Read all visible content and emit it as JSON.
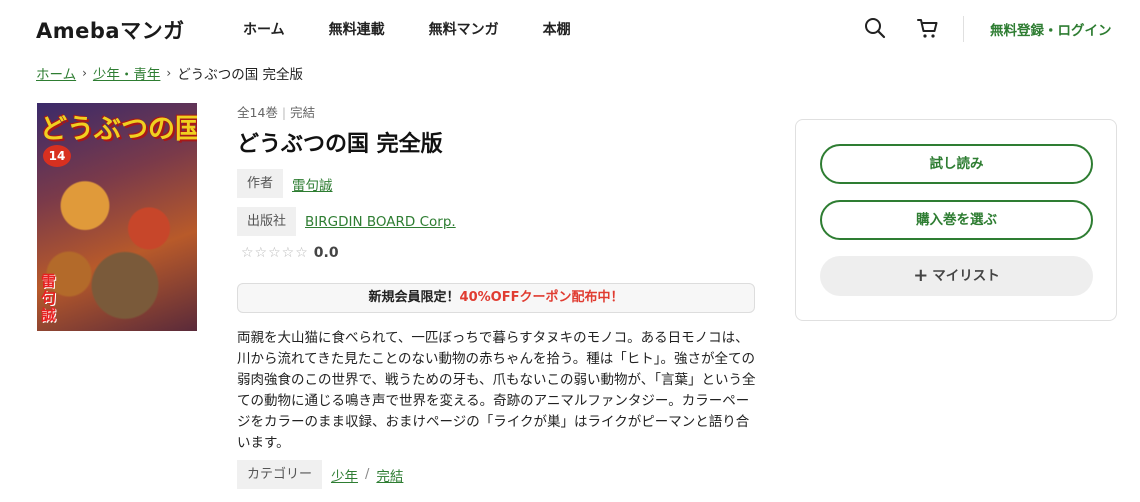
{
  "header": {
    "logo": "Amebaマンガ",
    "nav": [
      "ホーム",
      "無料連載",
      "無料マンガ",
      "本棚"
    ],
    "login": "無料登録・ログイン"
  },
  "breadcrumb": {
    "items": [
      "ホーム",
      "少年・青年"
    ],
    "current": "どうぶつの国 完全版"
  },
  "cover": {
    "title": "どうぶつの国",
    "volume": "14",
    "author": "雷句誠"
  },
  "book": {
    "volumes": "全14巻",
    "status": "完結",
    "title": "どうぶつの国 完全版",
    "author_label": "作者",
    "author": "雷句誠",
    "publisher_label": "出版社",
    "publisher": "BIRGDIN BOARD Corp.",
    "stars": "☆☆☆☆☆",
    "rating": "0.0"
  },
  "coupon": {
    "prefix": "新規会員限定！",
    "highlight": "40%OFFクーポン配布中！"
  },
  "description": "両親を大山猫に食べられて、一匹ぼっちで暮らすタヌキのモノコ。ある日モノコは、川から流れてきた見たことのない動物の赤ちゃんを拾う。種は「ヒト」。強さが全ての弱肉強食のこの世界で、戦うための牙も、爪もないこの弱い動物が、「言葉」という全ての動物に通じる鳴き声で世界を変える。奇跡のアニマルファンタジー。カラーページをカラーのまま収録、おまけページの「ライクが巣」はライクがピーマンと語り合います。",
  "category": {
    "label": "カテゴリー",
    "items": [
      "少年",
      "完結"
    ]
  },
  "actions": {
    "trial": "試し読み",
    "purchase": "購入巻を選ぶ",
    "mylist": "マイリスト"
  },
  "colors": {
    "accent": "#2e7d32",
    "highlight": "#e03c31"
  }
}
